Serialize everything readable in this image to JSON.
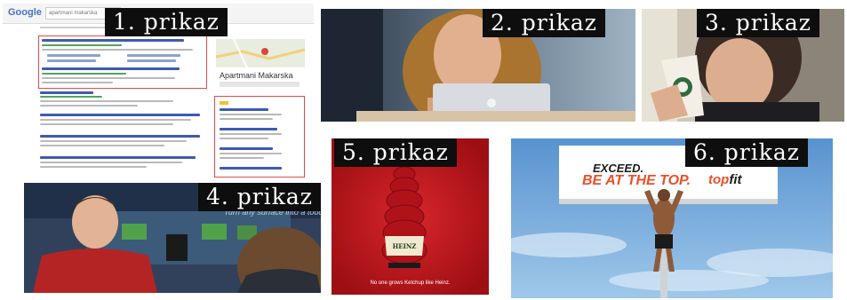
{
  "panels": [
    {
      "label": "1. prikaz"
    },
    {
      "label": "2. prikaz"
    },
    {
      "label": "3. prikaz"
    },
    {
      "label": "4. prikaz"
    },
    {
      "label": "5. prikaz"
    },
    {
      "label": "6. prikaz"
    }
  ],
  "search": {
    "logo": "Google",
    "query": "apartmani makarska",
    "map_title": "Apartmani Makarska"
  },
  "billboard": {
    "line1": "EXCEED.",
    "line2": "BE AT THE TOP.",
    "brand_top": "top",
    "brand_fit": "fit"
  },
  "ketchup": {
    "tagline": "No one grows Ketchup like Heinz."
  },
  "tv": {
    "banner": "Turn any surface into a touchscreen"
  },
  "colors": {
    "label_bg": "#0e0e0e",
    "ketchup_red": "#c8151b",
    "sky_blue": "#6fa7d9",
    "brand_orange": "#e8502a"
  }
}
